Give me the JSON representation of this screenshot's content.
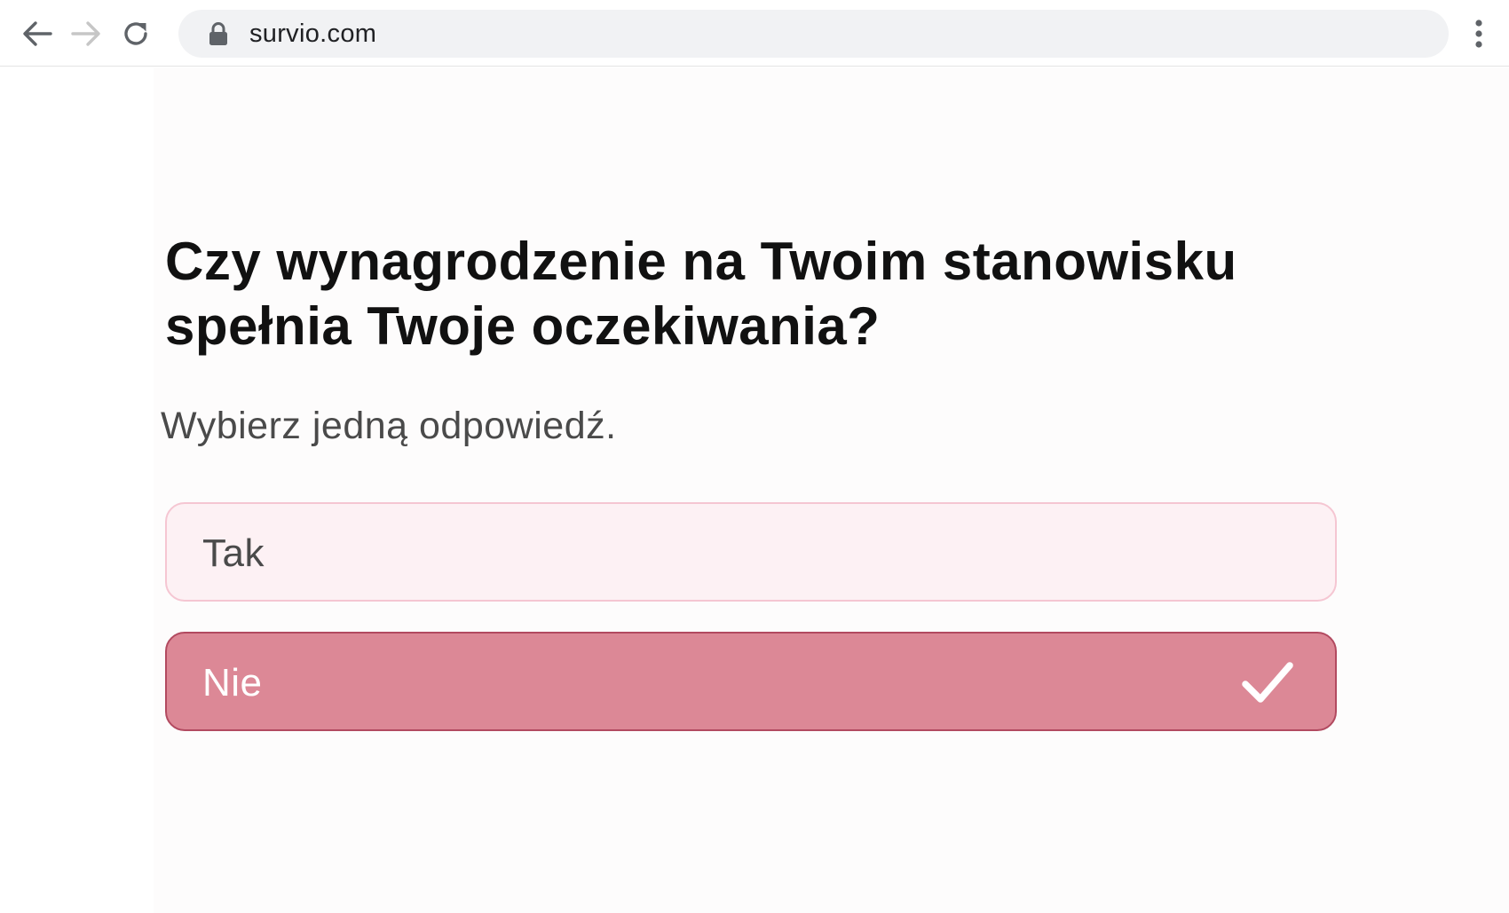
{
  "browser": {
    "url": "survio.com",
    "icons": {
      "back": "arrow-left-icon",
      "forward": "arrow-right-icon",
      "reload": "reload-icon",
      "lock": "lock-icon",
      "menu": "more-vertical-icon"
    }
  },
  "survey": {
    "question": "Czy wynagrodzenie na Twoim stanowisku spełnia Twoje oczekiwania?",
    "instruction": "Wybierz jedną odpowiedź.",
    "options": [
      {
        "label": "Tak",
        "selected": false
      },
      {
        "label": "Nie",
        "selected": true
      }
    ]
  },
  "colors": {
    "selected_fill": "#dc8896",
    "selected_border": "#b24a60",
    "unselected_fill": "#fdf1f4",
    "unselected_border": "#f5c6d2"
  }
}
